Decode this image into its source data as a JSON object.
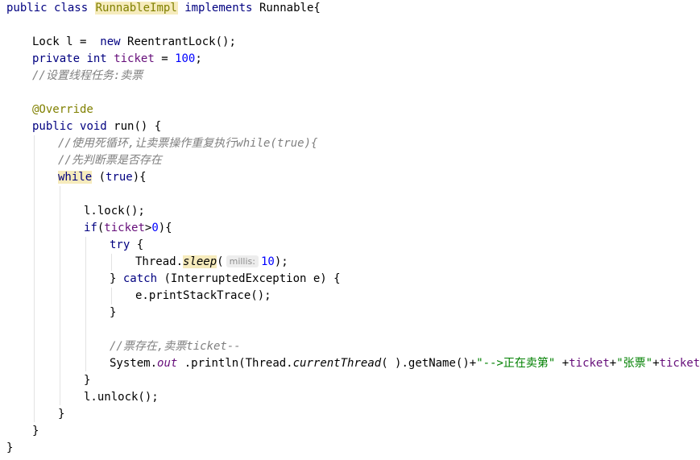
{
  "code": {
    "l1": {
      "kw_public": "public",
      "kw_class": "class",
      "class_name": "RunnableImpl",
      "kw_implements": "implements",
      "iface": "Runnable{"
    },
    "l2": {
      "type": "Lock",
      "rest": " l =  ",
      "kw_new": "new",
      "ctor": " ReentrantLock();"
    },
    "l3": {
      "kw_private": "private",
      "kw_int": "int",
      "field": "ticket",
      "eq": " = ",
      "value": "100",
      "semi": ";"
    },
    "l4": {
      "comment": "//设置线程任务:卖票"
    },
    "l5": {
      "annotation": "@Override"
    },
    "l6": {
      "kw_public": "public",
      "kw_void": "void",
      "rest": " run() {"
    },
    "l7": {
      "comment": "//使用死循环,让卖票操作重复执行while(true){"
    },
    "l8": {
      "comment": "//先判断票是否存在"
    },
    "l9": {
      "kw_while": "while",
      "open": " (",
      "kw_true": "true",
      "close": "){"
    },
    "l10": {
      "text": "l.lock();"
    },
    "l11": {
      "kw_if": "if",
      "open": "(",
      "field": "ticket",
      "op": ">",
      "value": "0",
      "close": "){"
    },
    "l12": {
      "kw_try": "try",
      "rest": " {"
    },
    "l13": {
      "pre": "Thread.",
      "method": "sleep",
      "paren": "(",
      "hint": "millis:",
      "value": "10",
      "close": ");"
    },
    "l14": {
      "pre": "} ",
      "kw_catch": "catch",
      "rest": " (InterruptedException e) {"
    },
    "l15": {
      "text": "e.printStackTrace();"
    },
    "l16": {
      "text": "}"
    },
    "l17": {
      "comment": "//票存在,卖票ticket--"
    },
    "l18": {
      "pre": "System.",
      "out": "out",
      "mid": " .println(Thread.",
      "method": "currentThread",
      "mid2": "( ).getName()+",
      "str1": "\"-->正在卖第\"",
      "plus1": " +",
      "field1": "ticket",
      "plus2": "+",
      "str2": "\"张票\"",
      "plus3": "+",
      "field2": "ticket",
      "end": "--);"
    },
    "l19": {
      "text": "}"
    },
    "l20": {
      "text": "l.unlock();"
    },
    "l21": {
      "text": "}"
    },
    "l22": {
      "text": "}"
    },
    "l23": {
      "text": "}"
    }
  }
}
